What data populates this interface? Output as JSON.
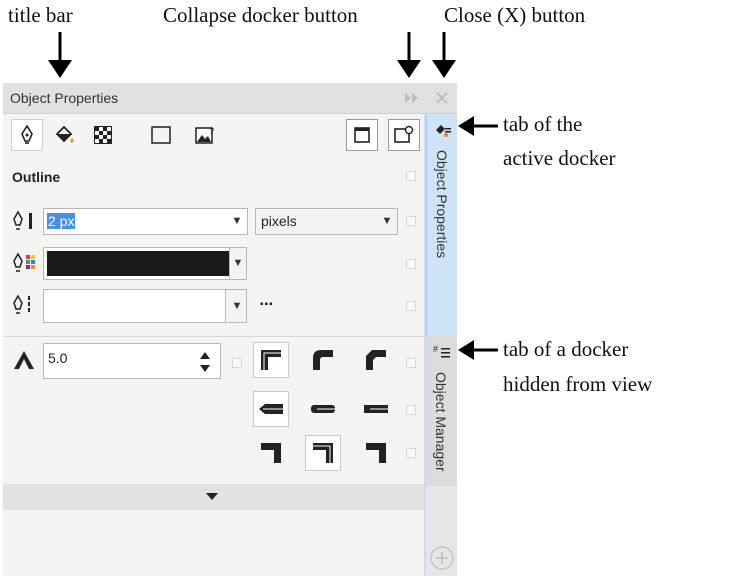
{
  "annotations": {
    "title_bar": "title bar",
    "collapse": "Collapse docker button",
    "close": "Close (X) button",
    "active_tab_line1": "tab of the",
    "active_tab_line2": "active docker",
    "hidden_tab_line1": "tab of a docker",
    "hidden_tab_line2": "hidden from view"
  },
  "docker": {
    "title": "Object Properties",
    "collapse_icon": "double-chevron-right-icon",
    "close_icon": "close-icon"
  },
  "toolbar": {
    "icons": [
      "outline-pen-icon",
      "fill-bucket-icon",
      "transparency-icon",
      "frame-icon",
      "image-icon"
    ],
    "right_icons": [
      "frame-fit-icon",
      "frame-options-icon"
    ]
  },
  "outline": {
    "section_title": "Outline",
    "width_value": "2 px",
    "units_value": "pixels",
    "color_value": "#1a1a1a",
    "style_value": "",
    "more_label": "▪▪▪",
    "miter_value": "5.0"
  },
  "tabs": {
    "active": "Object Properties",
    "hidden": "Object Manager",
    "add_icon": "plus-circle-icon"
  },
  "colors": {
    "accent": "#3b8ee0",
    "selection": "#4a90e2",
    "active_tab": "#cfe3f7"
  }
}
